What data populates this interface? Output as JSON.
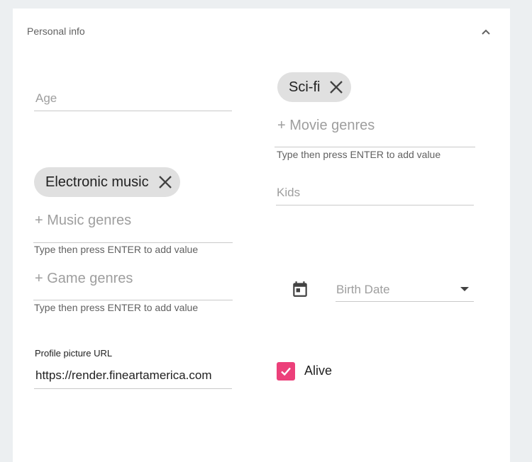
{
  "section": {
    "title": "Personal info",
    "collapse_icon": "chevron-up-icon"
  },
  "age": {
    "label": "Age"
  },
  "movie_genres": {
    "chips": [
      "Sci-fi"
    ],
    "add_label": "+ Movie genres",
    "helper": "Type then press ENTER to add value"
  },
  "kids": {
    "label": "Kids"
  },
  "music_genres": {
    "chips": [
      "Electronic music"
    ],
    "add_label": "+ Music genres",
    "helper": "Type then press ENTER to add value"
  },
  "game_genres": {
    "add_label": "+ Game genres",
    "helper": "Type then press ENTER to add value"
  },
  "birth_date": {
    "label": "Birth Date",
    "icon": "calendar-icon"
  },
  "profile_picture": {
    "label": "Profile picture URL",
    "value": "https://render.fineartamerica.com"
  },
  "alive": {
    "label": "Alive",
    "checked": true
  },
  "colors": {
    "accent": "#ec407a",
    "chip_bg": "#e0e0e0",
    "background": "#eceff1"
  }
}
